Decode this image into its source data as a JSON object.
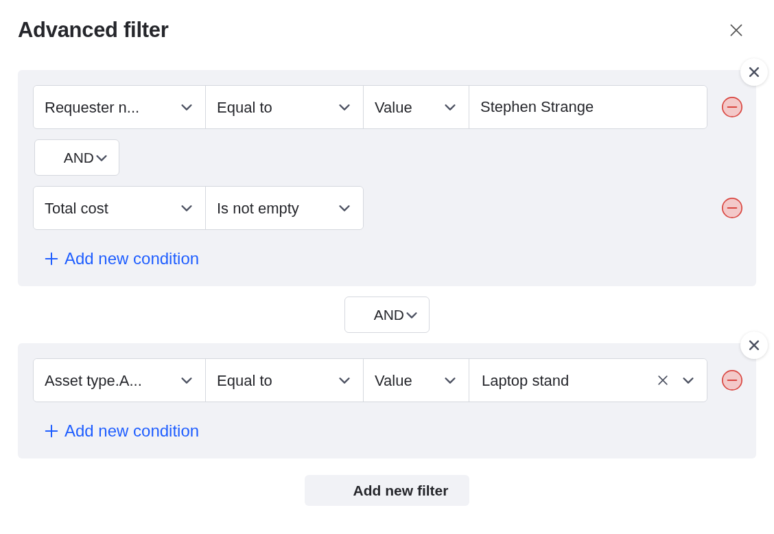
{
  "dialog": {
    "title": "Advanced filter"
  },
  "filters": [
    {
      "conditions": [
        {
          "kind": "value",
          "field": "Requester n...",
          "operator": "Equal to",
          "value_type": "Value",
          "value": {
            "kind": "text",
            "text": "Stephen Strange"
          }
        },
        {
          "kind": "no_value",
          "field": "Total cost",
          "operator": "Is not empty"
        }
      ],
      "joins": [
        "AND"
      ],
      "add_condition": "Add new condition"
    },
    {
      "conditions": [
        {
          "kind": "value",
          "field": "Asset type.A...",
          "operator": "Equal to",
          "value_type": "Value",
          "value": {
            "kind": "select",
            "text": "Laptop stand"
          }
        }
      ],
      "add_condition": "Add new condition"
    }
  ],
  "filter_joins": [
    "AND"
  ],
  "add_filter": "Add new filter"
}
